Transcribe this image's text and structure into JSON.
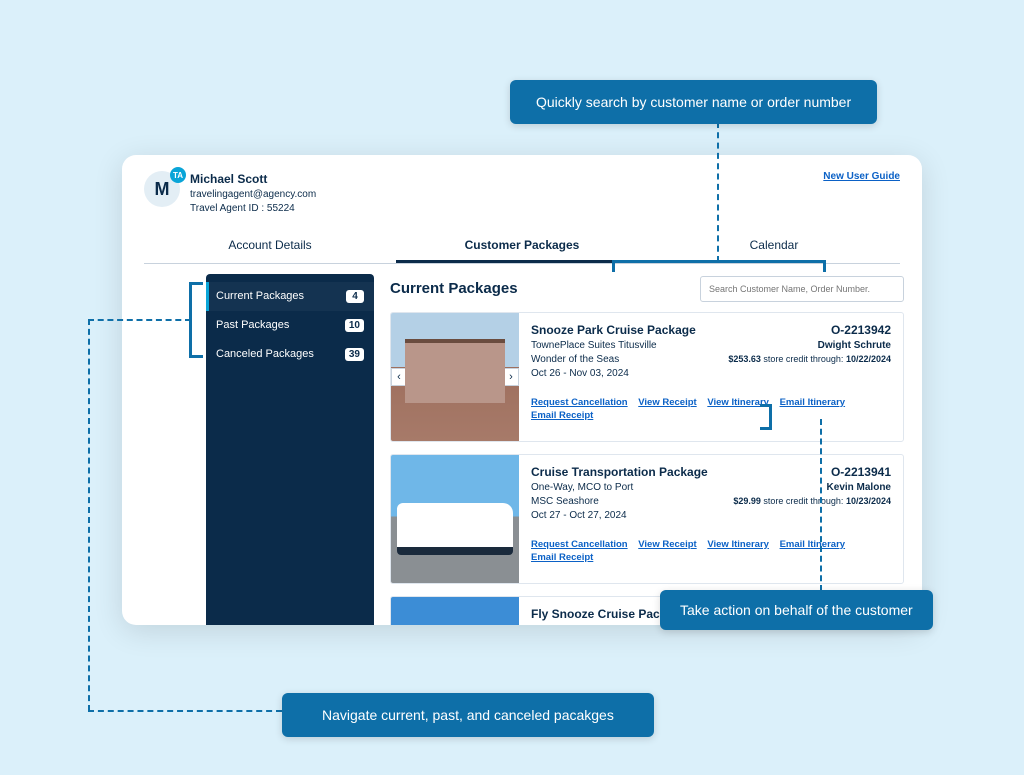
{
  "callouts": {
    "top": "Quickly search by customer name or order number",
    "right": "Take action on behalf of the customer",
    "bottom": "Navigate current, past, and canceled pacakges"
  },
  "profile": {
    "initial": "M",
    "badge": "TA",
    "name": "Michael Scott",
    "email": "travelingagent@agency.com",
    "agent_id_label": "Travel Agent ID : 55224"
  },
  "links": {
    "new_user_guide": "New User Guide"
  },
  "tabs": {
    "account": "Account Details",
    "packages": "Customer Packages",
    "calendar": "Calendar"
  },
  "sidebar": {
    "items": [
      {
        "label": "Current Packages",
        "count": "4"
      },
      {
        "label": "Past Packages",
        "count": "10"
      },
      {
        "label": "Canceled Packages",
        "count": "39"
      }
    ]
  },
  "main": {
    "title": "Current Packages",
    "search_placeholder": "Search Customer Name, Order Number."
  },
  "action_labels": {
    "cancel": "Request Cancellation",
    "receipt": "View Receipt",
    "itinerary": "View Itinerary",
    "email_itin": "Email Itinerary",
    "email_receipt": "Email Receipt"
  },
  "packages": [
    {
      "name": "Snooze Park Cruise Package",
      "order": "O-2213942",
      "location": "TownePlace Suites Titusville",
      "customer": "Dwight Schrute",
      "ship": "Wonder of the Seas",
      "credit_amount": "$253.63",
      "credit_mid": "store credit through:",
      "credit_date": "10/22/2024",
      "dates": "Oct 26 - Nov 03, 2024"
    },
    {
      "name": "Cruise Transportation Package",
      "order": "O-2213941",
      "location": "One-Way, MCO to Port",
      "customer": "Kevin Malone",
      "ship": "MSC Seashore",
      "credit_amount": "$29.99",
      "credit_mid": "store credit through:",
      "credit_date": "10/23/2024",
      "dates": "Oct 27 - Oct 27, 2024"
    },
    {
      "name": "Fly Snooze Cruise Package"
    }
  ]
}
